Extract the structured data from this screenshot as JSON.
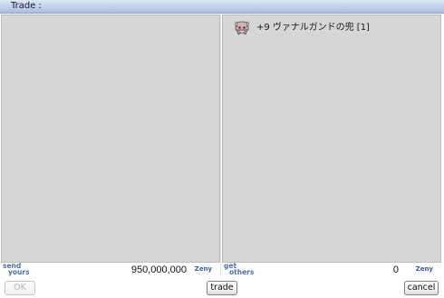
{
  "window": {
    "title": "Trade :"
  },
  "left_panel": {
    "tag_line1": "send",
    "tag_line2": "yours",
    "amount": "950,000,000",
    "currency": "Zeny"
  },
  "right_panel": {
    "tag_line1": "get",
    "tag_line2": "others",
    "amount": "0",
    "currency": "Zeny",
    "items": [
      {
        "name": "+9 ヴァナルガンドの兜 [1]",
        "icon": "helmet-icon"
      }
    ]
  },
  "buttons": {
    "ok": "OK",
    "trade": "trade",
    "cancel": "cancel"
  },
  "colors": {
    "pane_bg": "#d6d6d6",
    "tag_blue": "#4b6fb0",
    "title_gradient_top": "#dfe7f7",
    "title_gradient_bottom": "#aebddf"
  }
}
